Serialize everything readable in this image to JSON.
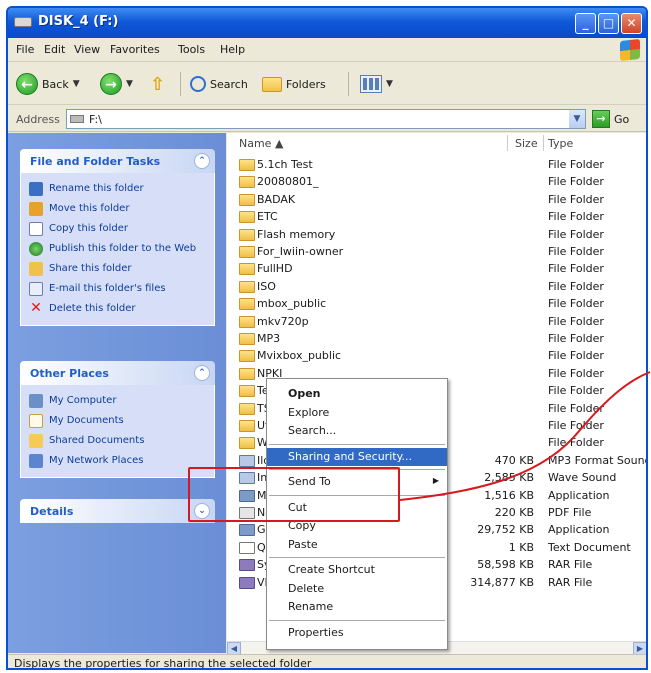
{
  "window": {
    "title": "DISK_4 (F:)"
  },
  "menubar": [
    "File",
    "Edit",
    "View",
    "Favorites",
    "Tools",
    "Help"
  ],
  "toolbar": {
    "back": "Back",
    "search": "Search",
    "folders": "Folders"
  },
  "address": {
    "label": "Address",
    "value": "F:\\",
    "go": "Go"
  },
  "tasks": {
    "folder_tasks_title": "File and Folder Tasks",
    "folder_tasks": [
      "Rename this folder",
      "Move this folder",
      "Copy this folder",
      "Publish this folder to the Web",
      "Share this folder",
      "E-mail this folder's files",
      "Delete this folder"
    ],
    "other_places_title": "Other Places",
    "other_places": [
      "My Computer",
      "My Documents",
      "Shared Documents",
      "My Network Places"
    ],
    "details_title": "Details"
  },
  "columns": {
    "name": "Name",
    "size": "Size",
    "type": "Type"
  },
  "files": [
    {
      "name": "5.1ch Test",
      "size": "",
      "type": "File Folder",
      "kind": "folder"
    },
    {
      "name": "20080801_",
      "size": "",
      "type": "File Folder",
      "kind": "folder"
    },
    {
      "name": "BADAK",
      "size": "",
      "type": "File Folder",
      "kind": "folder"
    },
    {
      "name": "ETC",
      "size": "",
      "type": "File Folder",
      "kind": "folder"
    },
    {
      "name": "Flash memory",
      "size": "",
      "type": "File Folder",
      "kind": "folder"
    },
    {
      "name": "For_Iwiin-owner",
      "size": "",
      "type": "File Folder",
      "kind": "folder"
    },
    {
      "name": "FullHD",
      "size": "",
      "type": "File Folder",
      "kind": "folder"
    },
    {
      "name": "ISO",
      "size": "",
      "type": "File Folder",
      "kind": "folder"
    },
    {
      "name": "mbox_public",
      "size": "",
      "type": "File Folder",
      "kind": "folder"
    },
    {
      "name": "mkv720p",
      "size": "",
      "type": "File Folder",
      "kind": "folder"
    },
    {
      "name": "MP3",
      "size": "",
      "type": "File Folder",
      "kind": "folder"
    },
    {
      "name": "Mvixbox_public",
      "size": "",
      "type": "File Folder",
      "kind": "folder"
    },
    {
      "name": "NPKI",
      "size": "",
      "type": "File Folder",
      "kind": "folder"
    },
    {
      "name": "Te",
      "size": "",
      "type": "File Folder",
      "kind": "folder"
    },
    {
      "name": "TS",
      "size": "",
      "type": "File Folder",
      "kind": "folder"
    },
    {
      "name": "Uti",
      "size": "",
      "type": "File Folder",
      "kind": "folder"
    },
    {
      "name": "WI",
      "size": "",
      "type": "File Folder",
      "kind": "folder"
    },
    {
      "name": "Ild",
      "size": "470 KB",
      "type": "MP3 Format Sound",
      "kind": "snd"
    },
    {
      "name": "Int",
      "size": "2,585 KB",
      "type": "Wave Sound",
      "kind": "snd"
    },
    {
      "name": "Ma",
      "size": "1,516 KB",
      "type": "Application",
      "kind": "app"
    },
    {
      "name": "Ne",
      "size": "220 KB",
      "type": "PDF File",
      "kind": "pdf"
    },
    {
      "name": "Gu",
      "size": "29,752 KB",
      "type": "Application",
      "kind": "app"
    },
    {
      "name": "Qu",
      "size": "1 KB",
      "type": "Text Document",
      "kind": "doc"
    },
    {
      "name": "Sy",
      "size": "58,598 KB",
      "type": "RAR File",
      "kind": "rar"
    },
    {
      "name": "VM",
      "size": "314,877 KB",
      "type": "RAR File",
      "kind": "rar"
    }
  ],
  "context_menu": {
    "items": [
      {
        "label": "Open",
        "bold": true
      },
      {
        "label": "Explore"
      },
      {
        "label": "Search..."
      },
      {
        "sep": true
      },
      {
        "label": "Sharing and Security...",
        "selected": true
      },
      {
        "sep": true
      },
      {
        "label": "Send To",
        "submenu": true
      },
      {
        "sep": true
      },
      {
        "label": "Cut"
      },
      {
        "label": "Copy"
      },
      {
        "label": "Paste"
      },
      {
        "sep": true
      },
      {
        "label": "Create Shortcut"
      },
      {
        "label": "Delete"
      },
      {
        "label": "Rename"
      },
      {
        "sep": true
      },
      {
        "label": "Properties"
      }
    ]
  },
  "status": {
    "text": "Displays the properties for sharing the selected folder"
  },
  "colors": {
    "annotation": "#d41a20",
    "selection": "#316ac5",
    "titlebar": "#0a4fd1"
  }
}
